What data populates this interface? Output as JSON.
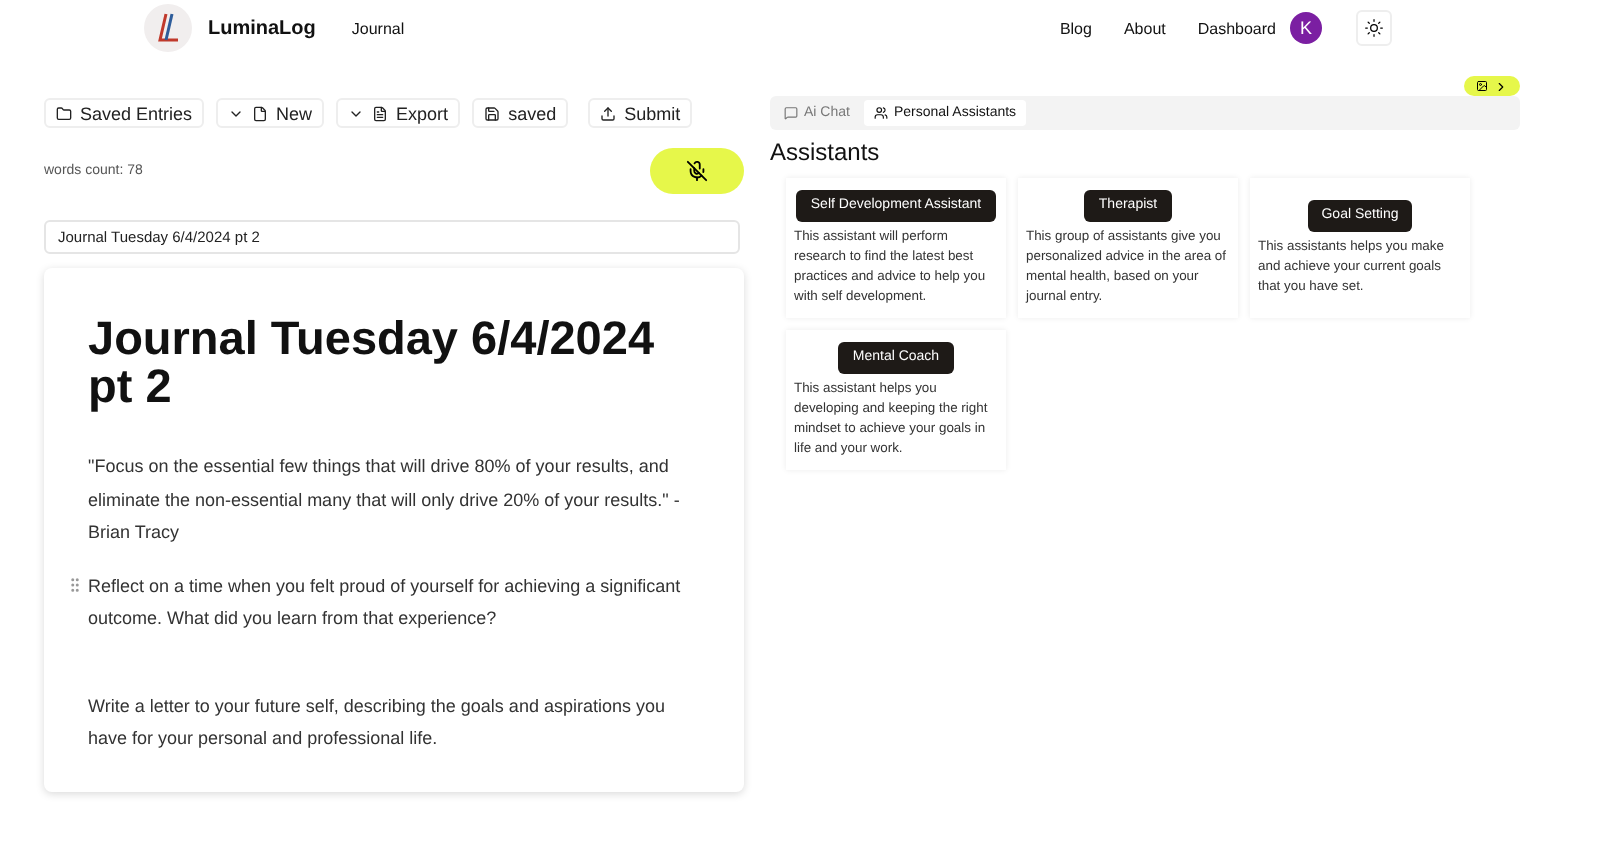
{
  "header": {
    "brand": "LuminaLog",
    "nav_left": [
      "Journal"
    ],
    "nav_right": [
      "Blog",
      "About",
      "Dashboard"
    ],
    "avatar": "K"
  },
  "toolbar": [
    {
      "label": "Saved Entries",
      "kind": "folder",
      "caret": false
    },
    {
      "label": "New",
      "kind": "file",
      "caret": true
    },
    {
      "label": "Export",
      "kind": "export",
      "caret": true
    },
    {
      "label": "saved",
      "kind": "save",
      "caret": false
    },
    {
      "label": "Submit",
      "kind": "upload",
      "caret": false
    }
  ],
  "words_count": "words count: 78",
  "mic_muted": true,
  "title_field": "Journal Tuesday 6/4/2024 pt 2",
  "editor": {
    "heading": "Journal Tuesday 6/4/2024 pt 2",
    "paragraphs": [
      {
        "text": "\"Focus on the essential few things that will drive 80% of your results, and eliminate the non-essential many that will only drive 20% of your results.\" - Brian Tracy",
        "handle": false
      },
      {
        "text": "Reflect on a time when you felt proud of yourself for achieving a significant outcome. What did you learn from that experience?",
        "handle": true
      },
      {
        "text": "Write a letter to your future self, describing the goals and aspirations you have for your personal and professional life.",
        "handle": false
      }
    ]
  },
  "tabs": [
    {
      "label": "Ai Chat",
      "selected": false
    },
    {
      "label": "Personal Assistants",
      "selected": true
    }
  ],
  "assistants_title": "Assistants",
  "assistants": [
    {
      "name": "Self Development Assistant",
      "description": "This assistant will perform research to find the latest best practices and advice to help you with self development."
    },
    {
      "name": "Therapist",
      "description": "This group of assistants give you personalized advice in the area of mental health, based on your journal entry."
    },
    {
      "name": "Goal Setting",
      "description": "This assistants helps you make and achieve your current goals that you have set."
    },
    {
      "name": "Mental Coach",
      "description": "This assistant helps you developing and keeping the right mindset to achieve your goals in life and your work."
    }
  ]
}
